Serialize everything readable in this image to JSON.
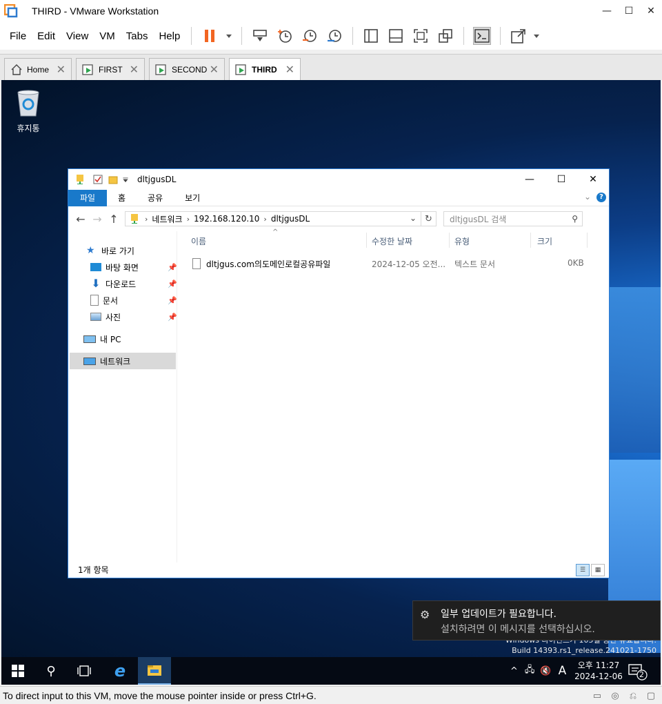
{
  "window": {
    "title": "THIRD - VMware Workstation"
  },
  "menu": [
    "File",
    "Edit",
    "View",
    "VM",
    "Tabs",
    "Help"
  ],
  "tabs": [
    {
      "label": "Home"
    },
    {
      "label": "FIRST"
    },
    {
      "label": "SECOND"
    },
    {
      "label": "THIRD",
      "active": true
    }
  ],
  "desktop": {
    "recycle_label": "휴지통",
    "watermark_line1": "Windows 라이선스가 105일 동안 유효합니다.",
    "watermark_line2": "Build 14393.rs1_release.241021-1750"
  },
  "explorer": {
    "title": "dltjgusDL",
    "ribbon": {
      "file": "파일",
      "home": "홈",
      "share": "공유",
      "view": "보기"
    },
    "address": {
      "crumbs": [
        "네트워크",
        "192.168.120.10",
        "dltjgusDL"
      ]
    },
    "search_placeholder": "dltjgusDL 검색",
    "nav": {
      "quick_access": "바로 가기",
      "desktop": "바탕 화면",
      "downloads": "다운로드",
      "documents": "문서",
      "pictures": "사진",
      "this_pc": "내 PC",
      "network": "네트워크"
    },
    "columns": {
      "name": "이름",
      "modified": "수정한 날짜",
      "type": "유형",
      "size": "크기"
    },
    "files": [
      {
        "name": "dltjgus.com의도메인로컬공유파일",
        "modified": "2024-12-05 오전...",
        "type": "텍스트 문서",
        "size": "0KB"
      }
    ],
    "status": "1개 항목"
  },
  "toast": {
    "title": "일부 업데이트가 필요합니다.",
    "body": "설치하려면 이 메시지를 선택하십시오."
  },
  "taskbar": {
    "time": "오후 11:27",
    "date": "2024-12-06",
    "ime": "A",
    "notification_count": "2"
  },
  "vm_status": "To direct input to this VM, move the mouse pointer inside or press Ctrl+G.",
  "colors": {
    "accent": "#1979ca",
    "pause": "#f26522",
    "desktop_dark": "#021228"
  }
}
